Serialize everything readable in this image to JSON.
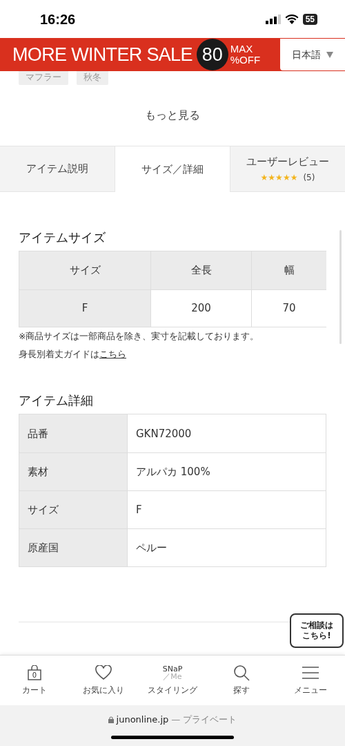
{
  "status_bar": {
    "time": "16:26",
    "battery": "55"
  },
  "banner": {
    "headline": "MORE WINTER SALE",
    "number": "80",
    "max": "MAX",
    "off": "%OFF",
    "language": "日本語"
  },
  "tags": [
    "マフラー",
    "秋冬"
  ],
  "more_link": "もっと見る",
  "tabs": [
    {
      "label": "アイテム説明",
      "selected": false
    },
    {
      "label": "サイズ／詳細",
      "selected": true
    },
    {
      "label": "ユーザーレビュー",
      "selected": false,
      "stars": 5,
      "count": "(5)"
    }
  ],
  "size_section": {
    "title": "アイテムサイズ",
    "columns": [
      "サイズ",
      "全長",
      "幅"
    ],
    "rows": [
      [
        "F",
        "200",
        "70"
      ]
    ],
    "note": "※商品サイズは一部商品を除き、実寸を記載しております。",
    "guide_text": "身長別着丈ガイドは",
    "guide_link": "こちら"
  },
  "detail_section": {
    "title": "アイテム詳細",
    "rows": [
      {
        "label": "品番",
        "value": "GKN72000"
      },
      {
        "label": "素材",
        "value": "アルパカ 100%"
      },
      {
        "label": "サイズ",
        "value": "F"
      },
      {
        "label": "原産国",
        "value": "ペルー"
      }
    ]
  },
  "chat_bubble": [
    "ご相談は",
    "こちら!"
  ],
  "bottom_nav": [
    {
      "kind": "cart",
      "label": "カート",
      "badge": "0"
    },
    {
      "kind": "heart",
      "label": "お気に入り"
    },
    {
      "kind": "logo",
      "label": "スタイリング",
      "logo_top": "SNaP",
      "logo_bottom": "／Me"
    },
    {
      "kind": "search",
      "label": "探す"
    },
    {
      "kind": "menu",
      "label": "メニュー"
    }
  ],
  "url_bar": {
    "domain": "junonline.jp",
    "suffix": "— プライベート"
  }
}
